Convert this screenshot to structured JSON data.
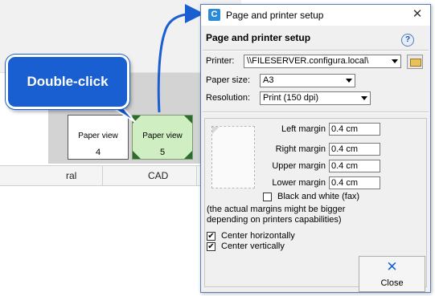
{
  "background_app": {
    "thumbnails": [
      {
        "label": "Paper view",
        "number": "4"
      },
      {
        "label": "Paper view",
        "number": "5"
      }
    ],
    "tabs": [
      "ral",
      "CAD"
    ]
  },
  "callout": {
    "text": "Double-click"
  },
  "dialog": {
    "window_title": "Page and printer setup",
    "heading": "Page and printer setup",
    "help_label": "?",
    "app_icon_letter": "C",
    "printer": {
      "label": "Printer:",
      "value": "\\\\FILESERVER.configura.local\\"
    },
    "paper_size": {
      "label": "Paper size:",
      "value": "A3"
    },
    "resolution": {
      "label": "Resolution:",
      "value": "Print (150 dpi)"
    },
    "margins": {
      "left": {
        "label": "Left margin",
        "value": "0.4 cm"
      },
      "right": {
        "label": "Right margin",
        "value": "0.4 cm"
      },
      "upper": {
        "label": "Upper margin",
        "value": "0.4 cm"
      },
      "lower": {
        "label": "Lower margin",
        "value": "0.4 cm"
      }
    },
    "black_and_white": {
      "label": "Black and white (fax)",
      "checked": false
    },
    "note_line1": "(the actual margins might be bigger",
    "note_line2": "depending on printers capabilities)",
    "center_horizontally": {
      "label": "Center horizontally",
      "checked": true
    },
    "center_vertically": {
      "label": "Center vertically",
      "checked": true
    },
    "close_button": {
      "label": "Close"
    },
    "checkmark": "✔"
  },
  "colors": {
    "accent": "#1a5fd1",
    "selected_thumb": "#cfeec1"
  }
}
